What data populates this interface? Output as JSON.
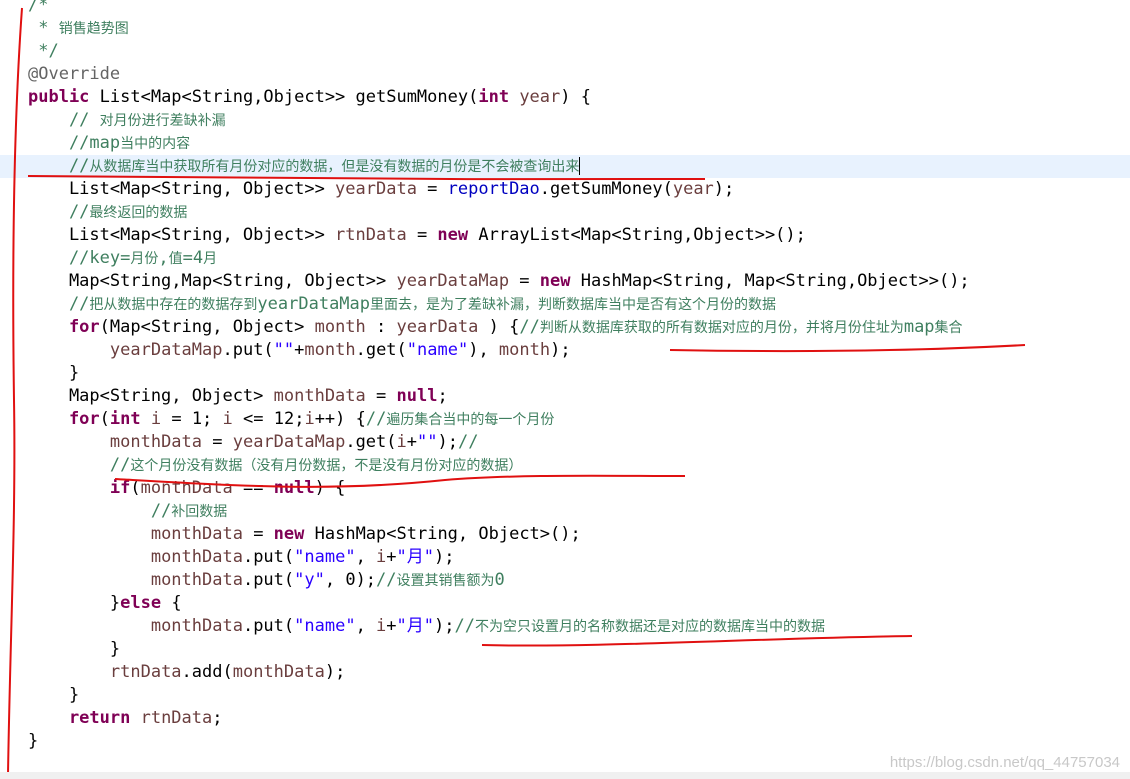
{
  "lines": [
    {
      "parts": [
        {
          "t": "/*",
          "c": "cm"
        }
      ]
    },
    {
      "parts": [
        {
          "t": " * ",
          "c": "cm"
        },
        {
          "t": "销售趋势图",
          "c": "cm cjk"
        }
      ]
    },
    {
      "parts": [
        {
          "t": " */",
          "c": "cm"
        }
      ]
    },
    {
      "parts": [
        {
          "t": "@Override",
          "c": "an"
        }
      ]
    },
    {
      "parts": [
        {
          "t": "public ",
          "c": "kw"
        },
        {
          "t": "List<Map<String,Object>> getSumMoney("
        },
        {
          "t": "int ",
          "c": "kw"
        },
        {
          "t": "year",
          "c": "lv"
        },
        {
          "t": ") {"
        }
      ]
    },
    {
      "parts": [
        {
          "t": "    // ",
          "c": "cm"
        },
        {
          "t": "对月份进行差缺补漏",
          "c": "cm cjk"
        }
      ]
    },
    {
      "parts": [
        {
          "t": "    //map",
          "c": "cm"
        },
        {
          "t": "当中的内容",
          "c": "cm cjk"
        }
      ]
    },
    {
      "current": true,
      "caret": true,
      "parts": [
        {
          "t": "    //",
          "c": "cm"
        },
        {
          "t": "从数据库当中获取所有月份对应的数据，但是没有数据的月份是不会被查询出来",
          "c": "cm cjk"
        }
      ]
    },
    {
      "parts": [
        {
          "t": "    List<Map<String, Object>> "
        },
        {
          "t": "yearData",
          "c": "lv"
        },
        {
          "t": " = "
        },
        {
          "t": "reportDao",
          "c": "fd"
        },
        {
          "t": ".getSumMoney("
        },
        {
          "t": "year",
          "c": "lv"
        },
        {
          "t": ");"
        }
      ]
    },
    {
      "parts": [
        {
          "t": "    //",
          "c": "cm"
        },
        {
          "t": "最终返回的数据",
          "c": "cm cjk"
        }
      ]
    },
    {
      "parts": [
        {
          "t": "    List<Map<String, Object>> "
        },
        {
          "t": "rtnData",
          "c": "lv"
        },
        {
          "t": " = "
        },
        {
          "t": "new ",
          "c": "kw"
        },
        {
          "t": "ArrayList<Map<String,Object>>();"
        }
      ]
    },
    {
      "parts": [
        {
          "t": "    //key=",
          "c": "cm"
        },
        {
          "t": "月份",
          "c": "cm cjk"
        },
        {
          "t": ",",
          "c": "cm"
        },
        {
          "t": "值",
          "c": "cm cjk"
        },
        {
          "t": "=4",
          "c": "cm"
        },
        {
          "t": "月",
          "c": "cm cjk"
        }
      ]
    },
    {
      "parts": [
        {
          "t": "    Map<String,Map<String, Object>> "
        },
        {
          "t": "yearDataMap",
          "c": "lv"
        },
        {
          "t": " = "
        },
        {
          "t": "new ",
          "c": "kw"
        },
        {
          "t": "HashMap<String, Map<String,Object>>();"
        }
      ]
    },
    {
      "parts": [
        {
          "t": "    //",
          "c": "cm"
        },
        {
          "t": "把从数据中存在的数据存到",
          "c": "cm cjk"
        },
        {
          "t": "yearDataMap",
          "c": "cm"
        },
        {
          "t": "里面去，是为了差缺补漏，判断数据库当中是否有这个月份的数据",
          "c": "cm cjk"
        }
      ]
    },
    {
      "parts": [
        {
          "t": "    for",
          "c": "kw"
        },
        {
          "t": "(Map<String, Object> "
        },
        {
          "t": "month",
          "c": "lv"
        },
        {
          "t": " : "
        },
        {
          "t": "yearData",
          "c": "lv"
        },
        {
          "t": " ) {"
        },
        {
          "t": "//",
          "c": "cm"
        },
        {
          "t": "判断从数据库获取的所有数据对应的月份，并将月份住址为",
          "c": "cm cjk"
        },
        {
          "t": "map",
          "c": "cm"
        },
        {
          "t": "集合",
          "c": "cm cjk"
        }
      ]
    },
    {
      "parts": [
        {
          "t": "        "
        },
        {
          "t": "yearDataMap",
          "c": "lv"
        },
        {
          "t": ".put("
        },
        {
          "t": "\"\"",
          "c": "st"
        },
        {
          "t": "+"
        },
        {
          "t": "month",
          "c": "lv"
        },
        {
          "t": ".get("
        },
        {
          "t": "\"name\"",
          "c": "st"
        },
        {
          "t": "), "
        },
        {
          "t": "month",
          "c": "lv"
        },
        {
          "t": ");"
        }
      ]
    },
    {
      "parts": [
        {
          "t": "    }"
        }
      ]
    },
    {
      "parts": [
        {
          "t": "    Map<String, Object> "
        },
        {
          "t": "monthData",
          "c": "lv"
        },
        {
          "t": " = "
        },
        {
          "t": "null",
          "c": "kw"
        },
        {
          "t": ";"
        }
      ]
    },
    {
      "parts": [
        {
          "t": "    for",
          "c": "kw"
        },
        {
          "t": "("
        },
        {
          "t": "int ",
          "c": "kw"
        },
        {
          "t": "i",
          "c": "lv"
        },
        {
          "t": " = 1; "
        },
        {
          "t": "i",
          "c": "lv"
        },
        {
          "t": " <= 12;"
        },
        {
          "t": "i",
          "c": "lv"
        },
        {
          "t": "++) {"
        },
        {
          "t": "//",
          "c": "cm"
        },
        {
          "t": "遍历集合当中的每一个月份",
          "c": "cm cjk"
        }
      ]
    },
    {
      "parts": [
        {
          "t": "        "
        },
        {
          "t": "monthData",
          "c": "lv"
        },
        {
          "t": " = "
        },
        {
          "t": "yearDataMap",
          "c": "lv"
        },
        {
          "t": ".get("
        },
        {
          "t": "i",
          "c": "lv"
        },
        {
          "t": "+"
        },
        {
          "t": "\"\"",
          "c": "st"
        },
        {
          "t": ");"
        },
        {
          "t": "//",
          "c": "cm"
        }
      ]
    },
    {
      "parts": [
        {
          "t": "        //",
          "c": "cm"
        },
        {
          "t": "这个月份没有数据（没有月份数据，不是没有月份对应的数据）",
          "c": "cm cjk"
        }
      ]
    },
    {
      "parts": [
        {
          "t": "        if",
          "c": "kw"
        },
        {
          "t": "("
        },
        {
          "t": "monthData",
          "c": "lv"
        },
        {
          "t": " == "
        },
        {
          "t": "null",
          "c": "kw"
        },
        {
          "t": ") {"
        }
      ]
    },
    {
      "parts": [
        {
          "t": "            //",
          "c": "cm"
        },
        {
          "t": "补回数据",
          "c": "cm cjk"
        }
      ]
    },
    {
      "parts": [
        {
          "t": "            "
        },
        {
          "t": "monthData",
          "c": "lv"
        },
        {
          "t": " = "
        },
        {
          "t": "new ",
          "c": "kw"
        },
        {
          "t": "HashMap<String, Object>();"
        }
      ]
    },
    {
      "parts": [
        {
          "t": "            "
        },
        {
          "t": "monthData",
          "c": "lv"
        },
        {
          "t": ".put("
        },
        {
          "t": "\"name\"",
          "c": "st"
        },
        {
          "t": ", "
        },
        {
          "t": "i",
          "c": "lv"
        },
        {
          "t": "+"
        },
        {
          "t": "\"月\"",
          "c": "st"
        },
        {
          "t": ");"
        }
      ]
    },
    {
      "parts": [
        {
          "t": "            "
        },
        {
          "t": "monthData",
          "c": "lv"
        },
        {
          "t": ".put("
        },
        {
          "t": "\"y\"",
          "c": "st"
        },
        {
          "t": ", 0);"
        },
        {
          "t": "//",
          "c": "cm"
        },
        {
          "t": "设置其销售额为",
          "c": "cm cjk"
        },
        {
          "t": "0",
          "c": "cm"
        }
      ]
    },
    {
      "parts": [
        {
          "t": "        }"
        },
        {
          "t": "else ",
          "c": "kw"
        },
        {
          "t": "{"
        }
      ]
    },
    {
      "parts": [
        {
          "t": "            "
        },
        {
          "t": "monthData",
          "c": "lv"
        },
        {
          "t": ".put("
        },
        {
          "t": "\"name\"",
          "c": "st"
        },
        {
          "t": ", "
        },
        {
          "t": "i",
          "c": "lv"
        },
        {
          "t": "+"
        },
        {
          "t": "\"月\"",
          "c": "st"
        },
        {
          "t": ");"
        },
        {
          "t": "//",
          "c": "cm"
        },
        {
          "t": "不为空只设置月的名称数据还是对应的数据库当中的数据",
          "c": "cm cjk"
        }
      ]
    },
    {
      "parts": [
        {
          "t": "        }"
        }
      ]
    },
    {
      "parts": [
        {
          "t": "        "
        },
        {
          "t": "rtnData",
          "c": "lv"
        },
        {
          "t": ".add("
        },
        {
          "t": "monthData",
          "c": "lv"
        },
        {
          "t": ");"
        }
      ]
    },
    {
      "parts": [
        {
          "t": "    }"
        }
      ]
    },
    {
      "parts": [
        {
          "t": "    return ",
          "c": "kw"
        },
        {
          "t": "rtnData",
          "c": "lv"
        },
        {
          "t": ";"
        }
      ]
    },
    {
      "parts": [
        {
          "t": "}"
        }
      ]
    }
  ],
  "watermark": "https://blog.csdn.net/qq_44757034",
  "colors": {
    "keyword": "#7f0055",
    "comment": "#3f7f5f",
    "annotation": "#646464",
    "field": "#0000c0",
    "local_variable": "#6a3e3e",
    "string": "#2a00ff",
    "current_line": "#e8f2fe",
    "pen_mark": "#e01010"
  }
}
